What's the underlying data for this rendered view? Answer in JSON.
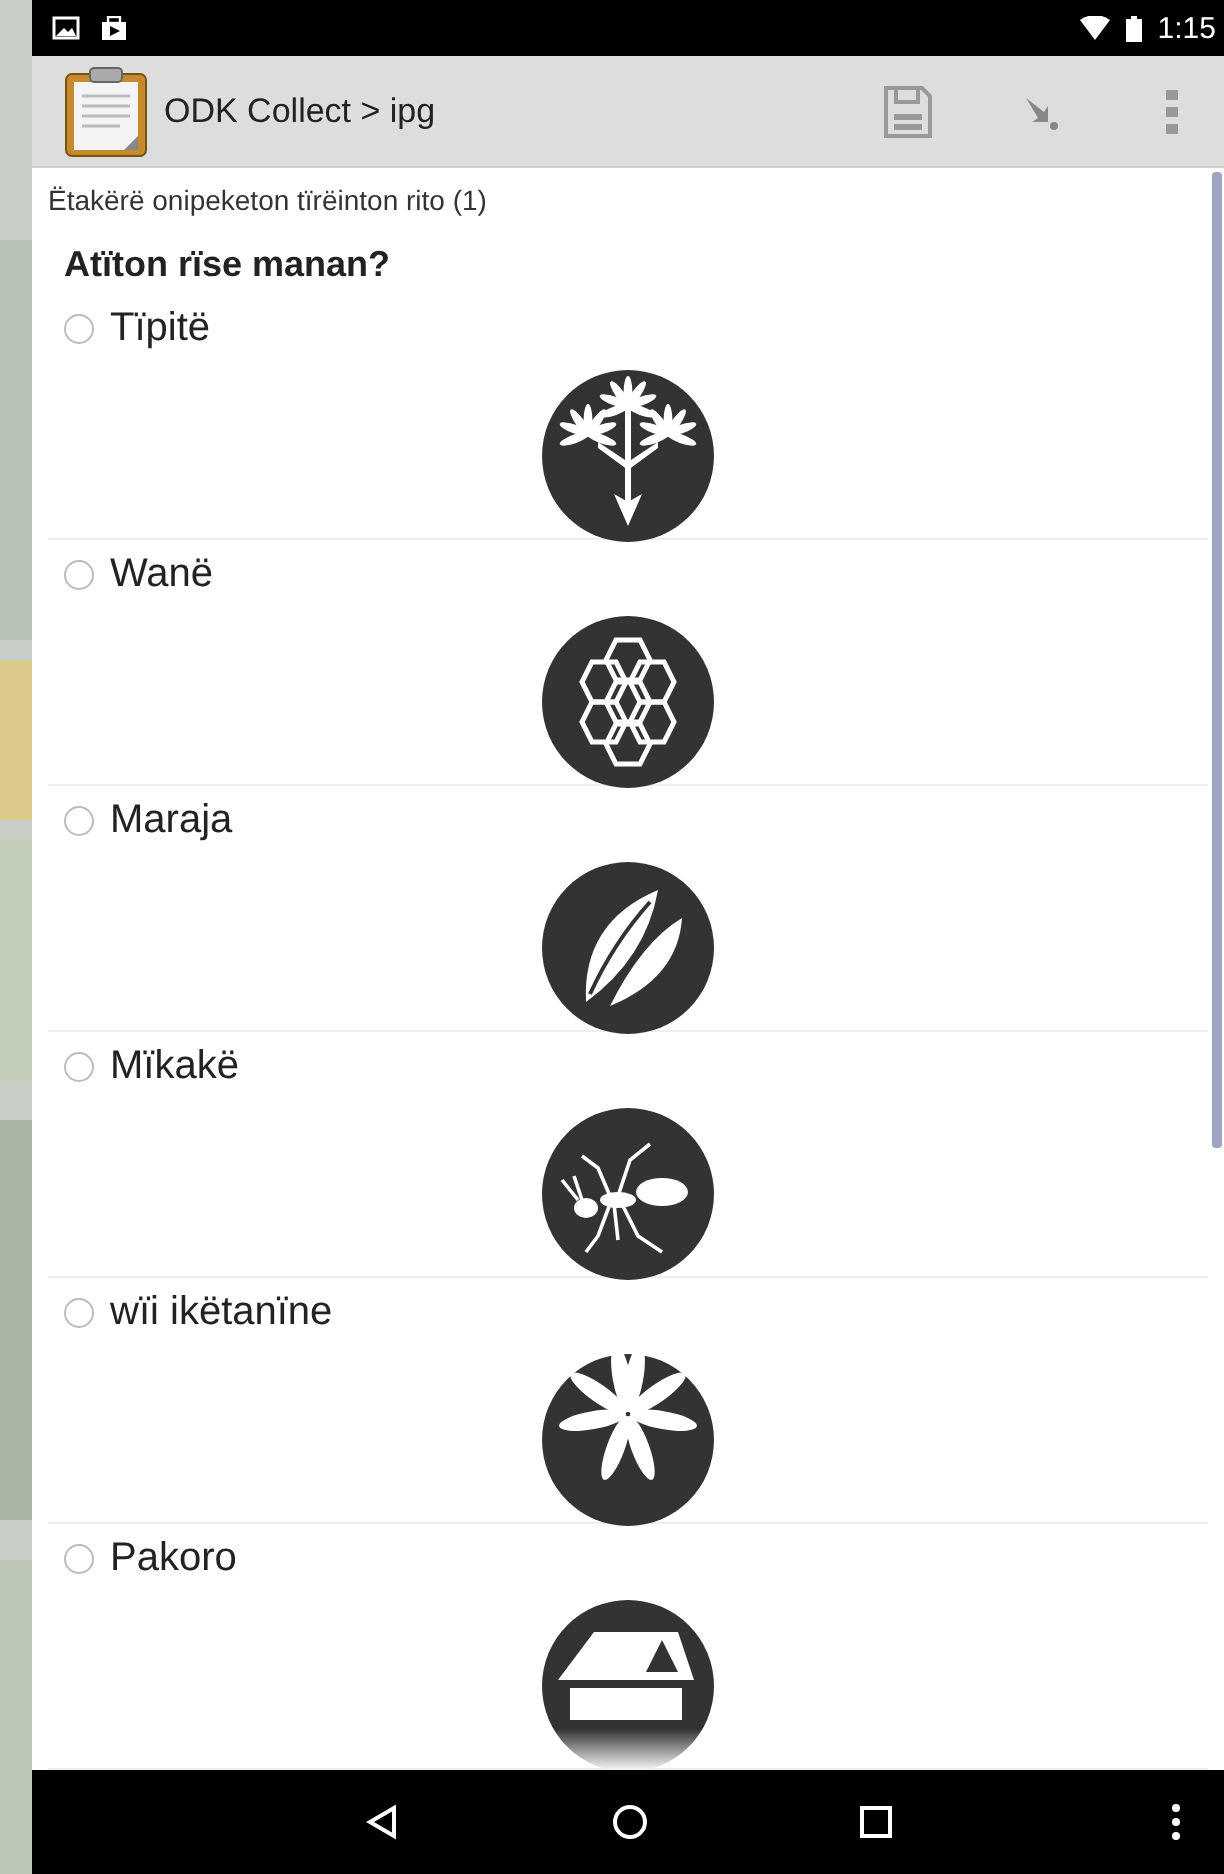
{
  "status_bar": {
    "time": "1:15"
  },
  "app_bar": {
    "title": "ODK Collect > ipg"
  },
  "group_label": "Ëtakërë onipeketon tïrëinton rito (1)",
  "question": "Atïton rïse manan?",
  "options": [
    {
      "label": "Tïpitë",
      "selected": false
    },
    {
      "label": "Wanë",
      "selected": false
    },
    {
      "label": "Maraja",
      "selected": false
    },
    {
      "label": "Mïkakë",
      "selected": false
    },
    {
      "label": "wïi ikëtanïne",
      "selected": false
    },
    {
      "label": "Pakoro",
      "selected": false
    }
  ]
}
